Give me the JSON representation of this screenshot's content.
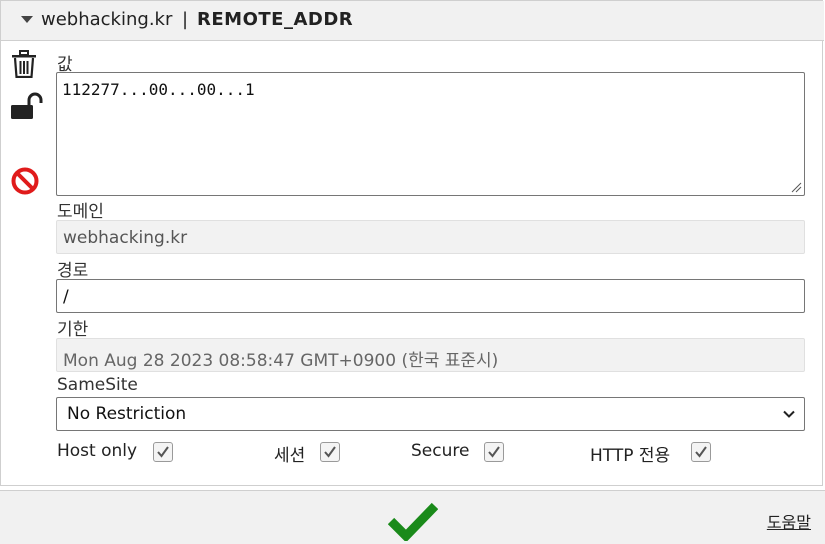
{
  "header": {
    "domain": "webhacking.kr",
    "separator": "|",
    "cookie_name": "REMOTE_ADDR"
  },
  "icons": {
    "delete": "trash-icon",
    "protect": "unlock-icon",
    "block": "block-icon"
  },
  "value": {
    "label": "값",
    "text": "112277...00...00...1"
  },
  "domain": {
    "label": "도메인",
    "value": "webhacking.kr"
  },
  "path": {
    "label": "경로",
    "value": "/"
  },
  "expiry": {
    "label": "기한",
    "value": "Mon Aug 28 2023 08:58:47 GMT+0900 (한국 표준시)"
  },
  "samesite": {
    "label": "SameSite",
    "selected": "No Restriction"
  },
  "flags": {
    "host_only": {
      "label": "Host only",
      "checked": true
    },
    "session": {
      "label": "세션",
      "checked": true
    },
    "secure": {
      "label": "Secure",
      "checked": true
    },
    "http_only": {
      "label": "HTTP 전용",
      "checked": true
    }
  },
  "footer": {
    "help_label": "도움말"
  },
  "colors": {
    "accent_green": "#1a8a1a",
    "block_red": "#e01b1b",
    "header_bg": "#f1f1f1"
  }
}
